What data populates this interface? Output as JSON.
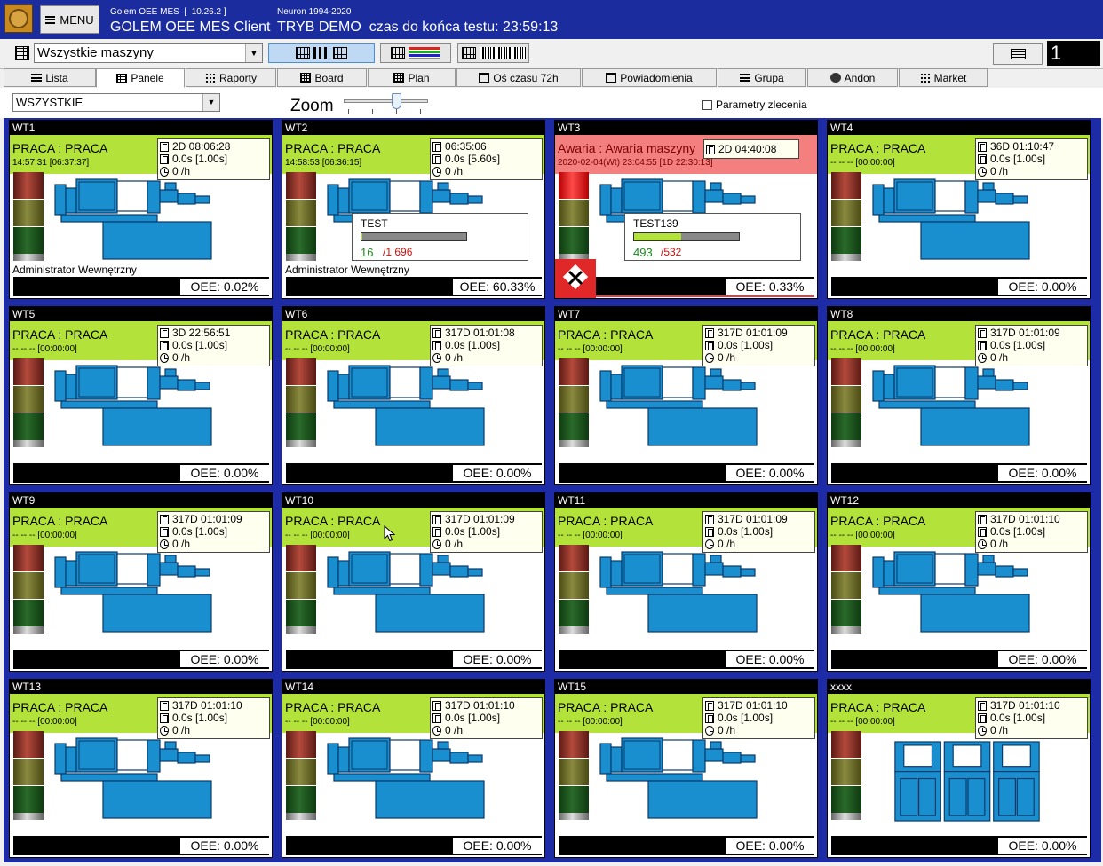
{
  "header": {
    "menu_label": "MENU",
    "app_version": "Golem OEE MES  [  10.26.2 ]",
    "app_name": "GOLEM OEE MES Client",
    "copyright": "Neuron 1994-2020",
    "demo_text": "TRYB DEMO  czas do końca testu: 23:59:13"
  },
  "toolbar": {
    "machine_select_value": "Wszystkie maszyny",
    "counter": "1"
  },
  "tabs": [
    {
      "label": "Lista",
      "icon": "list-icon"
    },
    {
      "label": "Panele",
      "icon": "grid-icon"
    },
    {
      "label": "Raporty",
      "icon": "dots-icon"
    },
    {
      "label": "Board",
      "icon": "grid-icon"
    },
    {
      "label": "Plan",
      "icon": "grid-icon"
    },
    {
      "label": "Oś czasu 72h",
      "icon": "calendar-icon"
    },
    {
      "label": "Powiadomienia",
      "icon": "window-icon"
    },
    {
      "label": "Grupa",
      "icon": "list-icon"
    },
    {
      "label": "Andon",
      "icon": "chat-icon"
    },
    {
      "label": "Market",
      "icon": "dots-icon"
    }
  ],
  "filter": {
    "select_value": "WSZYSTKIE",
    "zoom_label": "Zoom",
    "params_label": "Parametry zlecenia"
  },
  "colors": {
    "frame_blue": "#1d2ba6",
    "status_ok": "#b3e33a",
    "status_alarm": "#f47f7f",
    "machine_blue": "#1a8fd0"
  },
  "panels": [
    {
      "name": "WT1",
      "status": "PRACA : PRACA",
      "sub": "14:57:31  [06:37:37]",
      "time": "2D 08:06:28",
      "cycle": "0.0s [1.00s]",
      "rate": "0 /h",
      "user": "Administrator Wewnętrzny",
      "oee": "OEE: 0.02%"
    },
    {
      "name": "WT2",
      "status": "PRACA : PRACA",
      "sub": "14:58:53  [06:36:15]",
      "time": "06:35:06",
      "cycle": "0.0s [5.60s]",
      "rate": "0 /h",
      "user": "Administrator Wewnętrzny",
      "oee": "OEE: 60.33%",
      "order": {
        "name": "TEST",
        "count": "16",
        "total": "/1 696",
        "progress": 0.01
      }
    },
    {
      "name": "WT3",
      "status": "Awaria : Awaria maszyny",
      "sub": "2020-02-04(Wt) 23:04:55  [1D 22:30:13]",
      "time": "2D 04:40:08",
      "cycle": "",
      "rate": "",
      "user": "",
      "oee": "OEE: 0.33%",
      "alarm": true,
      "order": {
        "name": "TEST139",
        "count": "493",
        "total": "/532",
        "progress": 0.45
      }
    },
    {
      "name": "WT4",
      "status": "PRACA : PRACA",
      "sub": "-- -- --   [00:00:00]",
      "time": "36D 01:10:47",
      "cycle": "0.0s [1.00s]",
      "rate": "0 /h",
      "user": "",
      "oee": "OEE: 0.00%"
    },
    {
      "name": "WT5",
      "status": "PRACA : PRACA",
      "sub": "-- -- --   [00:00:00]",
      "time": "3D 22:56:51",
      "cycle": "0.0s [1.00s]",
      "rate": "0 /h",
      "user": "",
      "oee": "OEE: 0.00%"
    },
    {
      "name": "WT6",
      "status": "PRACA : PRACA",
      "sub": "-- -- --   [00:00:00]",
      "time": "317D 01:01:08",
      "cycle": "0.0s [1.00s]",
      "rate": "0 /h",
      "user": "",
      "oee": "OEE: 0.00%"
    },
    {
      "name": "WT7",
      "status": "PRACA : PRACA",
      "sub": "-- -- --   [00:00:00]",
      "time": "317D 01:01:09",
      "cycle": "0.0s [1.00s]",
      "rate": "0 /h",
      "user": "",
      "oee": "OEE: 0.00%"
    },
    {
      "name": "WT8",
      "status": "PRACA : PRACA",
      "sub": "-- -- --   [00:00:00]",
      "time": "317D 01:01:09",
      "cycle": "0.0s [1.00s]",
      "rate": "0 /h",
      "user": "",
      "oee": "OEE: 0.00%"
    },
    {
      "name": "WT9",
      "status": "PRACA : PRACA",
      "sub": "-- -- --   [00:00:00]",
      "time": "317D 01:01:09",
      "cycle": "0.0s [1.00s]",
      "rate": "0 /h",
      "user": "",
      "oee": "OEE: 0.00%"
    },
    {
      "name": "WT10",
      "status": "PRACA : PRACA",
      "sub": "-- -- --   [00:00:00]",
      "time": "317D 01:01:09",
      "cycle": "0.0s [1.00s]",
      "rate": "0 /h",
      "user": "",
      "oee": "OEE: 0.00%"
    },
    {
      "name": "WT11",
      "status": "PRACA : PRACA",
      "sub": "-- -- --   [00:00:00]",
      "time": "317D 01:01:09",
      "cycle": "0.0s [1.00s]",
      "rate": "0 /h",
      "user": "",
      "oee": "OEE: 0.00%"
    },
    {
      "name": "WT12",
      "status": "PRACA : PRACA",
      "sub": "-- -- --   [00:00:00]",
      "time": "317D 01:01:10",
      "cycle": "0.0s [1.00s]",
      "rate": "0 /h",
      "user": "",
      "oee": "OEE: 0.00%"
    },
    {
      "name": "WT13",
      "status": "PRACA : PRACA",
      "sub": "-- -- --   [00:00:00]",
      "time": "317D 01:01:10",
      "cycle": "0.0s [1.00s]",
      "rate": "0 /h",
      "user": "",
      "oee": "OEE: 0.00%"
    },
    {
      "name": "WT14",
      "status": "PRACA : PRACA",
      "sub": "-- -- --   [00:00:00]",
      "time": "317D 01:01:10",
      "cycle": "0.0s [1.00s]",
      "rate": "0 /h",
      "user": "",
      "oee": "OEE: 0.00%"
    },
    {
      "name": "WT15",
      "status": "PRACA : PRACA",
      "sub": "-- -- --   [00:00:00]",
      "time": "317D 01:01:10",
      "cycle": "0.0s [1.00s]",
      "rate": "0 /h",
      "user": "",
      "oee": "OEE: 0.00%"
    },
    {
      "name": "xxxx",
      "status": "PRACA : PRACA",
      "sub": "-- -- --   [00:00:00]",
      "time": "317D 01:01:10",
      "cycle": "0.0s [1.00s]",
      "rate": "0 /h",
      "user": "",
      "oee": "OEE: 0.00%",
      "cabinet": true
    }
  ]
}
